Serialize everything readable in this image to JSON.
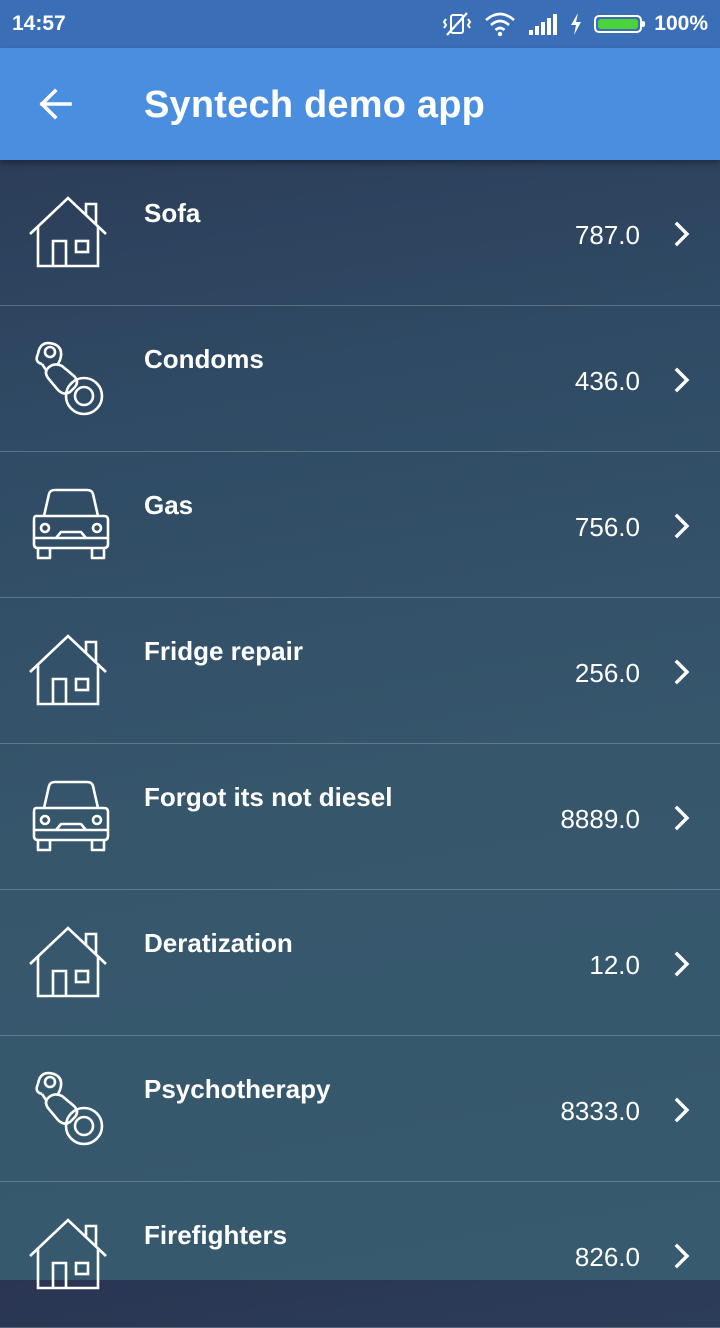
{
  "status_bar": {
    "time": "14:57",
    "battery_percent": "100%",
    "battery_level": 1.0,
    "icons": [
      "vibrate-off-icon",
      "wifi-icon",
      "signal-icon",
      "charging-icon",
      "battery-icon"
    ]
  },
  "app_bar": {
    "title": "Syntech demo app",
    "back_icon": "arrow-back-icon"
  },
  "items": [
    {
      "name": "Sofa",
      "amount": "787.0",
      "icon": "house-icon"
    },
    {
      "name": "Condoms",
      "amount": "436.0",
      "icon": "pacifier-icon"
    },
    {
      "name": "Gas",
      "amount": "756.0",
      "icon": "car-icon"
    },
    {
      "name": "Fridge repair",
      "amount": "256.0",
      "icon": "house-icon"
    },
    {
      "name": "Forgot its not diesel",
      "amount": "8889.0",
      "icon": "car-icon"
    },
    {
      "name": "Deratization",
      "amount": "12.0",
      "icon": "house-icon"
    },
    {
      "name": "Psychotherapy",
      "amount": "8333.0",
      "icon": "pacifier-icon"
    },
    {
      "name": "Firefighters",
      "amount": "826.0",
      "icon": "house-icon"
    }
  ]
}
